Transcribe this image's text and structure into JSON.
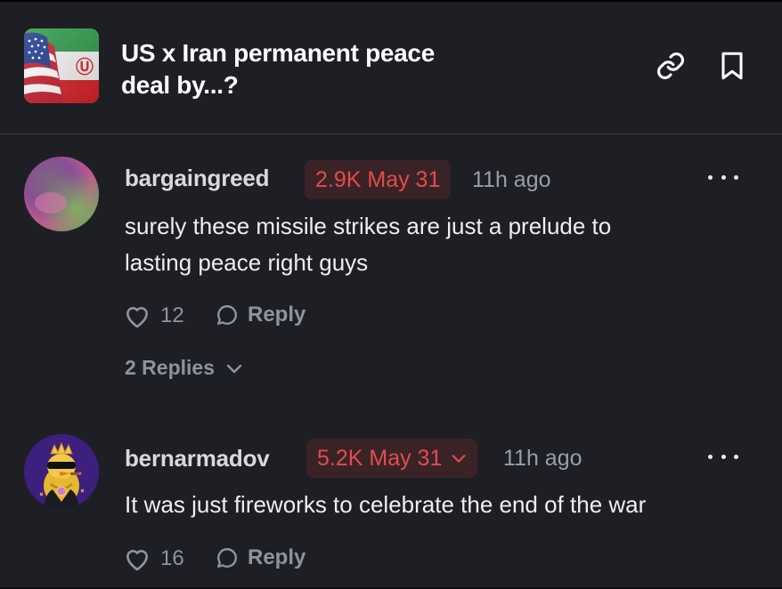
{
  "market": {
    "title": "US x Iran permanent peace deal by...?",
    "title_line1": "US x Iran permanent peace",
    "title_line2": "deal by...?",
    "thumbnail_icon": "us-iran-flag-image",
    "header_actions": [
      "link-icon",
      "bookmark-icon"
    ]
  },
  "colors": {
    "background": "#1d1f25",
    "badge_bg": "#3a2327",
    "badge_text": "#e24c4c",
    "muted_text": "#9a9ea7"
  },
  "comments": [
    {
      "username": "bargaingreed",
      "position": "2.9K May 31",
      "has_chevron": false,
      "time": "11h ago",
      "text_line1": "surely these missile strikes are just a prelude to",
      "text_line2": "lasting peace right guys",
      "likes": "12",
      "reply_label": "Reply",
      "replies_label": "2 Replies"
    },
    {
      "username": "bernarmadov",
      "position": "5.2K May 31",
      "has_chevron": true,
      "time": "11h ago",
      "text_line1": "It was just fireworks to celebrate the end of the war",
      "likes": "16",
      "reply_label": "Reply"
    }
  ]
}
